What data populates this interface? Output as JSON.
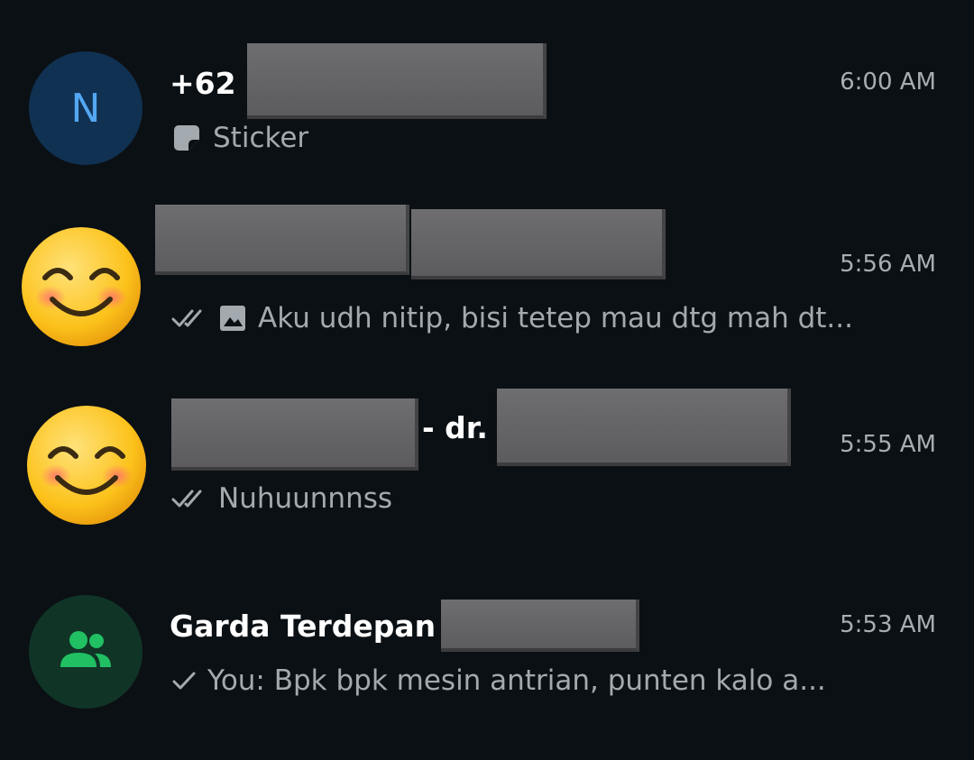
{
  "chats": [
    {
      "name_prefix": "+62",
      "time": "6:00 AM",
      "avatar_letter": "N",
      "preview_icon": "sticker-icon",
      "preview_text": "Sticker"
    },
    {
      "time": "5:56 AM",
      "avatar_icon": "smiling-face-emoji",
      "status_icon": "double-check-icon",
      "preview_icon": "image-icon",
      "preview_text": "Aku udh nitip, bisi tetep mau dtg mah dt..."
    },
    {
      "name_mid": "- dr.",
      "time": "5:55 AM",
      "avatar_icon": "smiling-face-emoji",
      "status_icon": "double-check-icon",
      "preview_text": "Nuhuunnnss"
    },
    {
      "name_prefix": "Garda Terdepan",
      "time": "5:53 AM",
      "avatar_icon": "group-icon",
      "status_icon": "single-check-icon",
      "preview_text": "You: Bpk bpk mesin antrian, punten kalo a..."
    }
  ],
  "colors": {
    "background": "#0b1014",
    "name": "#ffffff",
    "secondary_text": "#a3aaaf",
    "letter_avatar_bg": "#103152",
    "letter_avatar_fg": "#53a7f2",
    "group_avatar_bg": "#103527",
    "group_avatar_fg": "#21c063",
    "redaction": "#656567"
  }
}
